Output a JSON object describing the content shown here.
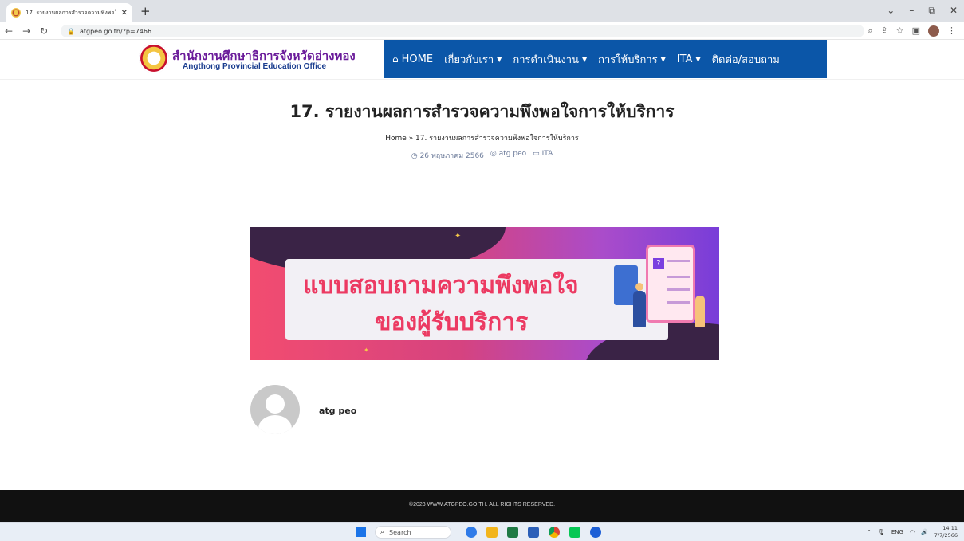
{
  "browser": {
    "tab_title": "17. รายงานผลการสำรวจความพึงพอใจ",
    "tab_close": "✕",
    "new_tab": "+",
    "url": "atgpeo.go.th/?p=7466",
    "window_controls": [
      "⌄",
      "–",
      "⧉",
      "✕"
    ]
  },
  "site": {
    "logo_th": "สำนักงานศึกษาธิการจังหวัดอ่างทอง",
    "logo_en": "Angthong Provincial Education Office",
    "nav": [
      {
        "label": "HOME",
        "icon": "home-icon",
        "dropdown": false
      },
      {
        "label": "เกี่ยวกับเรา",
        "dropdown": true
      },
      {
        "label": "การดำเนินงาน",
        "dropdown": true
      },
      {
        "label": "การให้บริการ",
        "dropdown": true
      },
      {
        "label": "ITA",
        "dropdown": true
      },
      {
        "label": "ติดต่อ/สอบถาม",
        "dropdown": false
      }
    ],
    "nav_accent": "#0b56a8"
  },
  "post": {
    "title": "17. รายงานผลการสำรวจความพึงพอใจการให้บริการ",
    "breadcrumb": "Home » 17. รายงานผลการสำรวจความพึงพอใจการให้บริการ",
    "date": "26 พฤษภาคม 2566",
    "author": "atg peo",
    "category": "ITA",
    "banner_line1": "แบบสอบถามความพึงพอใจ",
    "banner_line2": "ของผู้รับบริการ",
    "author_box_name": "atg peo"
  },
  "footer": {
    "copyright": "©2023 WWW.ATGPEO.GO.TH. ALL RIGHTS RESERVED."
  },
  "taskbar": {
    "search_placeholder": "Search",
    "lang": "ENG",
    "time": "14:11",
    "date": "7/7/2566"
  }
}
